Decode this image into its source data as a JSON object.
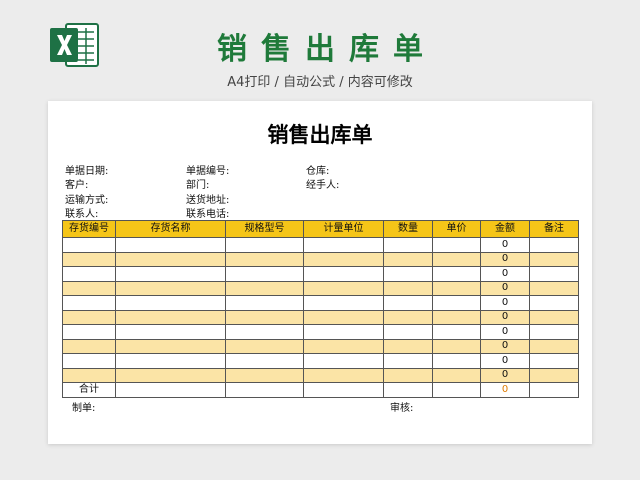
{
  "promo": {
    "title": "销售出库单",
    "subtitle": "A4打印 / 自动公式 / 内容可修改"
  },
  "document": {
    "title": "销售出库单",
    "info": {
      "doc_date": "单据日期:",
      "doc_number": "单据编号:",
      "warehouse": "仓库:",
      "customer": "客户:",
      "department": "部门:",
      "handler": "经手人:",
      "shipping_method": "运输方式:",
      "delivery_address": "送货地址:",
      "contact": "联系人:",
      "contact_phone": "联系电话:"
    },
    "table": {
      "headers": [
        "存货编号",
        "存货名称",
        "规格型号",
        "计量单位",
        "数量",
        "单价",
        "金额",
        "备注"
      ],
      "rows": [
        {
          "amount": "0"
        },
        {
          "amount": "0"
        },
        {
          "amount": "0"
        },
        {
          "amount": "0"
        },
        {
          "amount": "0"
        },
        {
          "amount": "0"
        },
        {
          "amount": "0"
        },
        {
          "amount": "0"
        },
        {
          "amount": "0"
        },
        {
          "amount": "0"
        }
      ],
      "total_label": "合计",
      "total_amount": "0"
    },
    "footer": {
      "made_by": "制单:",
      "reviewed_by": "审核:"
    }
  },
  "colors": {
    "brand_green": "#1f7a3a",
    "header_yellow": "#f5c518",
    "row_alt": "#fbe4a6",
    "total_orange": "#e07b00"
  },
  "icons": [
    "excel-logo-icon"
  ]
}
